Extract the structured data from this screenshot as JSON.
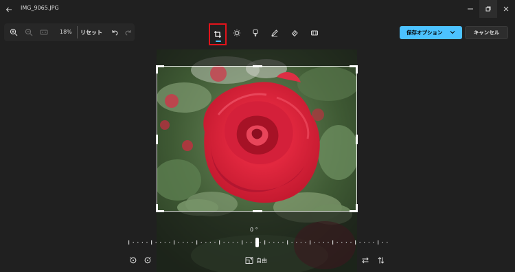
{
  "window": {
    "title": "IMG_9065.JPG"
  },
  "toolbar": {
    "zoom_percent": "18%",
    "reset_label": "リセット",
    "save_label": "保存オプション",
    "cancel_label": "キャンセル"
  },
  "tools": [
    "crop-rotate",
    "adjust",
    "filter",
    "markup",
    "erase",
    "background"
  ],
  "crop": {
    "angle_label": "0 °",
    "aspect_label": "自由"
  },
  "colors": {
    "accent": "#4cc2ff",
    "highlight_box": "#e3131b",
    "background": "#202020"
  }
}
